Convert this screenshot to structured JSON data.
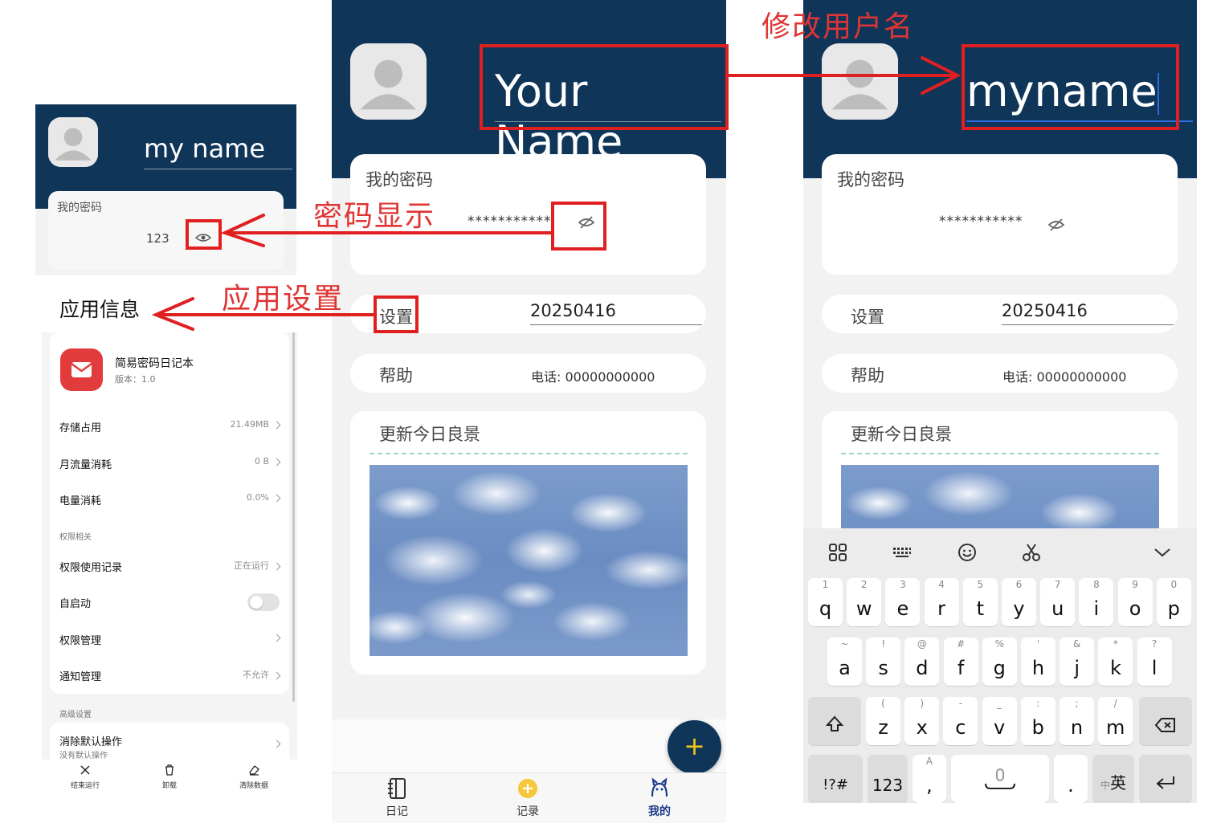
{
  "annotations": {
    "rename": "修改用户名",
    "show_password": "密码显示",
    "app_settings": "应用设置"
  },
  "panel_a": {
    "username": "my name",
    "password_label": "我的密码",
    "password_value": "123",
    "app_info_title": "应用信息",
    "app_name": "简易密码日记本",
    "app_version": "版本：1.0",
    "rows": [
      {
        "label": "存储占用",
        "value": "21.49MB"
      },
      {
        "label": "月流量消耗",
        "value": "0 B"
      },
      {
        "label": "电量消耗",
        "value": "0.0%"
      }
    ],
    "permission_section": "权限相关",
    "permission_rows": [
      {
        "label": "权限使用记录",
        "value": "正在运行"
      },
      {
        "label": "自启动",
        "value": ""
      },
      {
        "label": "权限管理",
        "value": ""
      },
      {
        "label": "通知管理",
        "value": "不允许"
      }
    ],
    "advanced_section": "高级设置",
    "clear_default": "消除默认操作",
    "clear_default_sub": "没有默认操作",
    "actions": [
      "结束运行",
      "卸载",
      "清除数据"
    ]
  },
  "panel_b": {
    "username": "Your Name",
    "password_label": "我的密码",
    "password_masked": "***********",
    "settings_label": "设置",
    "settings_value": "20250416",
    "help_label": "帮助",
    "help_value": "电话: 00000000000",
    "scenery_label": "更新今日良景",
    "nav": [
      "日记",
      "记录",
      "我的"
    ],
    "fab": "+"
  },
  "panel_c": {
    "username": "myname",
    "password_label": "我的密码",
    "password_masked": "***********",
    "settings_label": "设置",
    "settings_value": "20250416",
    "help_label": "帮助",
    "help_value": "电话: 00000000000",
    "scenery_label": "更新今日良景"
  },
  "keyboard": {
    "row1": [
      [
        "1",
        "q"
      ],
      [
        "2",
        "w"
      ],
      [
        "3",
        "e"
      ],
      [
        "4",
        "r"
      ],
      [
        "5",
        "t"
      ],
      [
        "6",
        "y"
      ],
      [
        "7",
        "u"
      ],
      [
        "8",
        "i"
      ],
      [
        "9",
        "o"
      ],
      [
        "0",
        "p"
      ]
    ],
    "row2": [
      [
        "~",
        "a"
      ],
      [
        "!",
        "s"
      ],
      [
        "@",
        "d"
      ],
      [
        "#",
        "f"
      ],
      [
        "%",
        "g"
      ],
      [
        "'",
        "h"
      ],
      [
        "&",
        "j"
      ],
      [
        "*",
        "k"
      ],
      [
        "?",
        "l"
      ]
    ],
    "row3": [
      [
        "(",
        "z"
      ],
      [
        ")",
        "x"
      ],
      [
        "-",
        "c"
      ],
      [
        "_",
        "v"
      ],
      [
        ":",
        "b"
      ],
      [
        ";",
        "n"
      ],
      [
        "/",
        "m"
      ]
    ],
    "sym": "!?#",
    "num": "123",
    "comma_sup": "A",
    "comma": ",",
    "period": ".",
    "lang_small": "中",
    "lang": "英"
  },
  "colors": {
    "header_navy": "#0f3559",
    "annotation_red": "#e02020",
    "app_icon_red": "#e23b3b",
    "nav_active": "#1c3a8a",
    "fab_star": "#f5c518"
  }
}
